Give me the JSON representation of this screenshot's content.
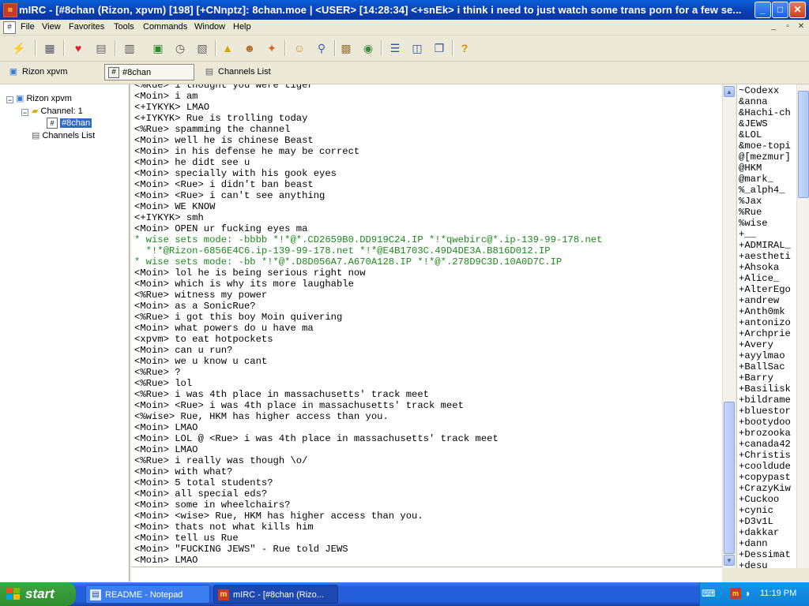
{
  "window": {
    "title": "mIRC - [#8chan (Rizon, xpvm) [198] [+CNnptz]: 8chan.moe  |  <USER> [14:28:34] <+snEk> i think i need to just watch some trans porn for a few se...",
    "app_icon_text": "mIRC",
    "minimize": "_",
    "maximize": "□",
    "close": "✕"
  },
  "menu": {
    "items": [
      "File",
      "View",
      "Favorites",
      "Tools",
      "Commands",
      "Window",
      "Help"
    ],
    "mdi_minimize": "_",
    "mdi_restore": "▫",
    "mdi_close": "✕"
  },
  "switchbar": {
    "items": [
      {
        "label": "Rizon xpvm",
        "icon": "server-icon"
      },
      {
        "label": "#8chan",
        "icon": "channel-icon"
      },
      {
        "label": "Channels List",
        "icon": "list-icon"
      }
    ]
  },
  "tree": {
    "server": "Rizon xpvm",
    "channel_group": "Channel: 1",
    "channel": "#8chan",
    "channels_list": "Channels List",
    "expand_minus": "−"
  },
  "chat": {
    "lines": [
      {
        "text": "<%Rue> i thought you were tiger",
        "type": "msg"
      },
      {
        "text": "<Moin> i am",
        "type": "msg"
      },
      {
        "text": "<+IYKYK> LMAO",
        "type": "msg"
      },
      {
        "text": "<+IYKYK> Rue is trolling today",
        "type": "msg"
      },
      {
        "text": "<%Rue> spamming the channel",
        "type": "msg"
      },
      {
        "text": "<Moin> well he is chinese Beast",
        "type": "msg"
      },
      {
        "text": "<Moin> in his defense he may be correct",
        "type": "msg"
      },
      {
        "text": "<Moin> he didt see u",
        "type": "msg"
      },
      {
        "text": "<Moin> specially with his gook eyes",
        "type": "msg"
      },
      {
        "text": "<Moin> <Rue> i didn't ban beast",
        "type": "msg"
      },
      {
        "text": "<Moin> <Rue> i can't see anything",
        "type": "msg"
      },
      {
        "text": "<Moin> WE KNOW",
        "type": "msg"
      },
      {
        "text": "<+IYKYK> smh",
        "type": "msg"
      },
      {
        "text": "<Moin> OPEN ur fucking eyes ma",
        "type": "msg"
      },
      {
        "text": "* wise sets mode: -bbbb *!*@*.CD2659B0.DD919C24.IP *!*qwebirc@*.ip-139-99-178.net",
        "type": "mode"
      },
      {
        "text": "  *!*@Rizon-6856E4C6.ip-139-99-178.net *!*@E4B1703C.49D4DE3A.B816D012.IP",
        "type": "mode"
      },
      {
        "text": "* wise sets mode: -bb *!*@*.D8D056A7.A670A128.IP *!*@*.278D9C3D.10A0D7C.IP",
        "type": "mode"
      },
      {
        "text": "<Moin> lol he is being serious right now",
        "type": "msg"
      },
      {
        "text": "<Moin> which is why its more laughable",
        "type": "msg"
      },
      {
        "text": "<%Rue> witness my power",
        "type": "msg"
      },
      {
        "text": "<Moin> as a SonicRue?",
        "type": "msg"
      },
      {
        "text": "<%Rue> i got this boy Moin quivering",
        "type": "msg"
      },
      {
        "text": "<Moin> what powers do u have ma",
        "type": "msg"
      },
      {
        "text": "<xpvm> to eat hotpockets",
        "type": "msg"
      },
      {
        "text": "<Moin> can u run?",
        "type": "msg"
      },
      {
        "text": "<Moin> we u know u cant",
        "type": "msg"
      },
      {
        "text": "<%Rue> ?",
        "type": "msg"
      },
      {
        "text": "<%Rue> lol",
        "type": "msg"
      },
      {
        "text": "<%Rue> i was 4th place in massachusetts' track meet",
        "type": "msg"
      },
      {
        "text": "<Moin> <Rue> i was 4th place in massachusetts' track meet",
        "type": "msg"
      },
      {
        "text": "<%wise> Rue, HKM has higher access than you.",
        "type": "msg"
      },
      {
        "text": "<Moin> LMAO",
        "type": "msg"
      },
      {
        "text": "<Moin> LOL @ <Rue> i was 4th place in massachusetts' track meet",
        "type": "msg"
      },
      {
        "text": "<Moin> LMAO",
        "type": "msg"
      },
      {
        "text": "<%Rue> i really was though \\o/",
        "type": "msg"
      },
      {
        "text": "<Moin> with what?",
        "type": "msg"
      },
      {
        "text": "<Moin> 5 total students?",
        "type": "msg"
      },
      {
        "text": "<Moin> all special eds?",
        "type": "msg"
      },
      {
        "text": "<Moin> some in wheelchairs?",
        "type": "msg"
      },
      {
        "text": "<Moin> <wise> Rue, HKM has higher access than you.",
        "type": "msg"
      },
      {
        "text": "<Moin> thats not what kills him",
        "type": "msg"
      },
      {
        "text": "<Moin> tell us Rue",
        "type": "msg"
      },
      {
        "text": "<Moin> \"FUCKING JEWS\" - Rue told JEWS",
        "type": "msg"
      },
      {
        "text": "<Moin> LMAO",
        "type": "msg"
      }
    ]
  },
  "nicklist": {
    "nicks": [
      "~Codexx",
      "&anna",
      "&Hachi-ch",
      "&JEWS",
      "&LOL",
      "&moe-topi",
      "@[mezmur]",
      "@HKM",
      "@mark_",
      "%_alph4_",
      "%Jax",
      "%Rue",
      "%wise",
      "+__",
      "+ADMIRAL_",
      "+aestheti",
      "+Ahsoka",
      "+Alice_",
      "+AlterEgo",
      "+andrew",
      "+Anth0mk",
      "+antonizo",
      "+Archprie",
      "+Avery",
      "+ayylmao",
      "+BallSac",
      "+Barry",
      "+Basilisk",
      "+bildrame",
      "+bluestor",
      "+bootydoo",
      "+brozooka",
      "+canada42",
      "+Christis",
      "+cooldude",
      "+copypast",
      "+CrazyKiw",
      "+Cuckoo",
      "+cynic",
      "+D3v1L",
      "+dakkar",
      "+dann",
      "+Dessimat",
      "+desu"
    ]
  },
  "taskbar": {
    "start_label": "start",
    "tasks": [
      {
        "label": "README - Notepad",
        "icon": "notepad-icon"
      },
      {
        "label": "mIRC - [#8chan (Rizo...",
        "icon": "mirc-icon"
      }
    ],
    "clock": "11:19 PM"
  }
}
